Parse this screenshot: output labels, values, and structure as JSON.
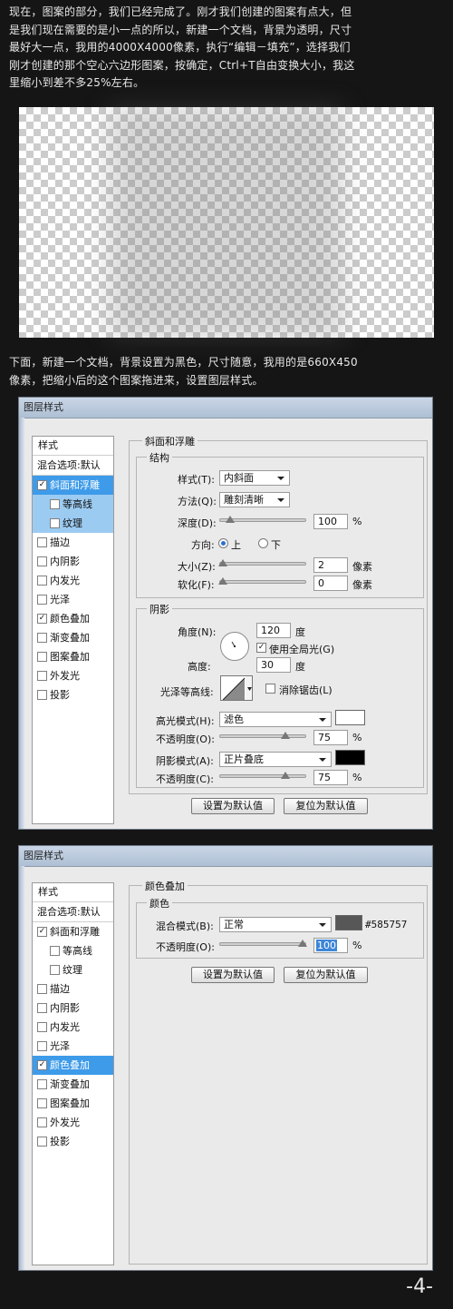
{
  "paragraph1": "现在，图案的部分，我们已经完成了。刚才我们创建的图案有点大，但\n是我们现在需要的是小一点的所以，新建一个文档，背景为透明，尺寸\n最好大一点，我用的4000X4000像素，执行“编辑－填充”，选择我们\n刚才创建的那个空心六边形图案，按确定，Ctrl+T自由变换大小，我这\n里缩小到差不多25%左右。",
  "paragraph2": "下面，新建一个文档，背景设置为黑色，尺寸随意，我用的是660X450\n像素，把缩小后的这个图案拖进来，设置图层样式。",
  "dialog1": {
    "title": "图层样式",
    "style_header": "样式",
    "blend_options": "混合选项:默认",
    "items": [
      "斜面和浮雕",
      "等高线",
      "纹理",
      "描边",
      "内阴影",
      "内发光",
      "光泽",
      "颜色叠加",
      "渐变叠加",
      "图案叠加",
      "外发光",
      "投影"
    ],
    "checked": [
      true,
      false,
      false,
      false,
      false,
      false,
      false,
      true,
      false,
      false,
      false,
      false
    ],
    "section_title": "斜面和浮雕",
    "structure": "结构",
    "style_label": "样式(T):",
    "style_value": "内斜面",
    "method_label": "方法(Q):",
    "method_value": "雕刻清晰",
    "depth_label": "深度(D):",
    "depth_value": "100",
    "depth_unit": "%",
    "direction_label": "方向:",
    "dir_up": "上",
    "dir_down": "下",
    "size_label": "大小(Z):",
    "size_value": "2",
    "size_unit": "像素",
    "soften_label": "软化(F):",
    "soften_value": "0",
    "soften_unit": "像素",
    "shading": "阴影",
    "angle_label": "角度(N):",
    "angle_value": "120",
    "deg": "度",
    "global_light": "使用全局光(G)",
    "altitude_label": "高度:",
    "altitude_value": "30",
    "gloss_label": "光泽等高线:",
    "antialias": "消除锯齿(L)",
    "highlight_label": "高光模式(H):",
    "highlight_value": "滤色",
    "opacity1_label": "不透明度(O):",
    "opacity1_value": "75",
    "percent": "%",
    "shadow_label": "阴影模式(A):",
    "shadow_value": "正片叠底",
    "opacity2_label": "不透明度(C):",
    "opacity2_value": "75",
    "btn_default": "设置为默认值",
    "btn_reset": "复位为默认值",
    "highlight_color": "#ffffff",
    "shadow_color": "#000000"
  },
  "dialog2": {
    "title": "图层样式",
    "style_header": "样式",
    "blend_options": "混合选项:默认",
    "section_title": "颜色叠加",
    "color_group": "颜色",
    "blend_label": "混合模式(B):",
    "blend_value": "正常",
    "color_hex": "#585757",
    "opacity_label": "不透明度(O):",
    "opacity_value": "100",
    "percent": "%",
    "btn_default": "设置为默认值",
    "btn_reset": "复位为默认值"
  },
  "page_number": "-4-"
}
